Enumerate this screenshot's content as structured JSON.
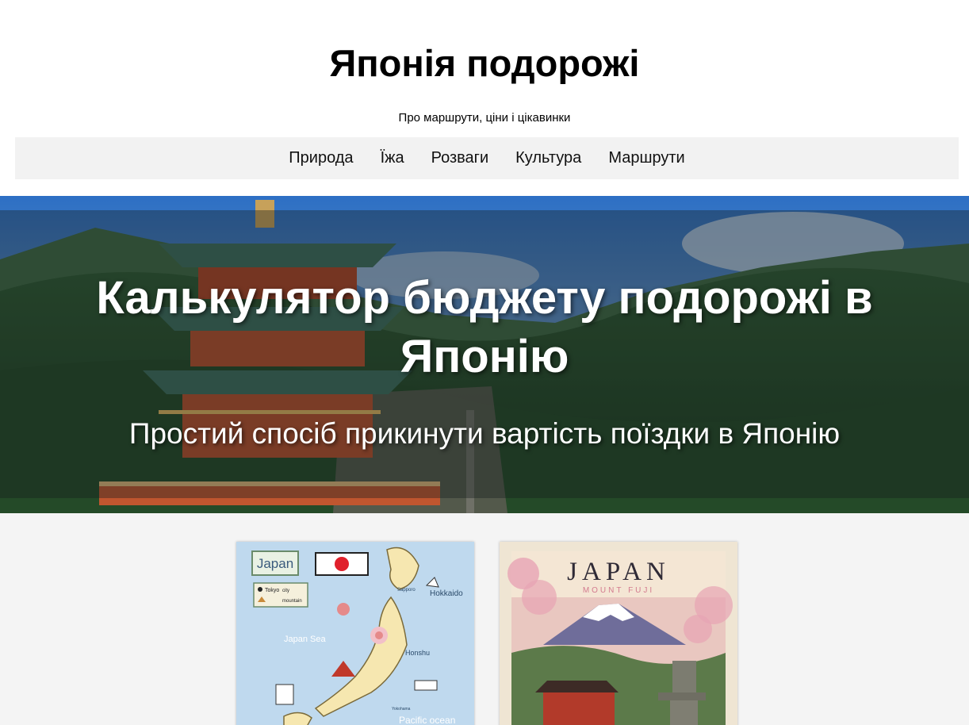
{
  "site": {
    "title": "Японія подорожі",
    "tagline": "Про маршрути, ціни і цікавинки"
  },
  "nav": {
    "items": [
      {
        "label": "Природа"
      },
      {
        "label": "Їжа"
      },
      {
        "label": "Розваги"
      },
      {
        "label": "Культура"
      },
      {
        "label": "Маршрути"
      }
    ]
  },
  "hero": {
    "title": "Калькулятор бюджету подорожі в Японію",
    "subtitle": "Простий спосіб прикинути вартість поїздки в Японію"
  },
  "cards": {
    "map": {
      "label": "Japan",
      "legend_city": "Tokyo",
      "legend_city_note": "city",
      "legend_mountain_note": "mountain",
      "sea_label": "Japan Sea",
      "island1": "Hokkaido",
      "island2": "Honshu",
      "city1": "Sapporo",
      "city2": "Yokohama",
      "ocean_label": "Pacific ocean"
    },
    "poster": {
      "title": "JAPAN",
      "subtitle": "MOUNT FUJI"
    }
  },
  "colors": {
    "nav_bg": "#f2f2f2",
    "cards_bg": "#f4f4f4",
    "map_bg": "#bfd9ee",
    "poster_bg": "#efe5d3"
  }
}
